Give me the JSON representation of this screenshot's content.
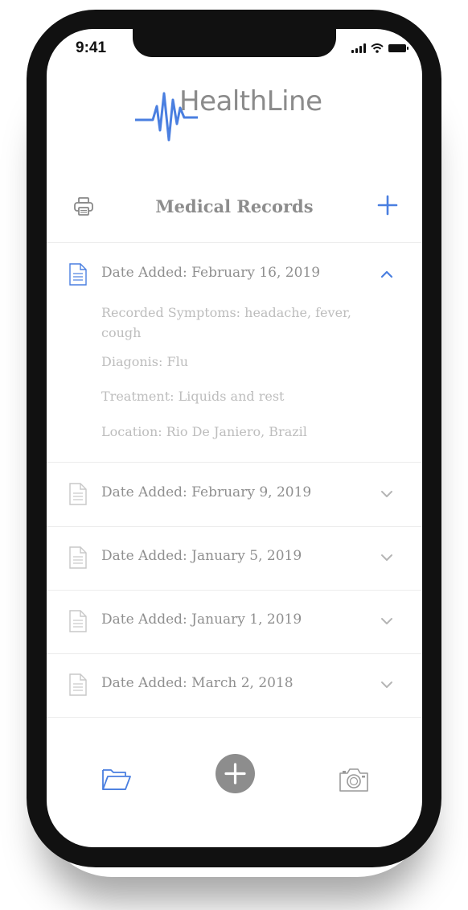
{
  "status_bar": {
    "time": "9:41"
  },
  "app": {
    "name": "HealthLine"
  },
  "header": {
    "title": "Medical Records"
  },
  "records": [
    {
      "date": "Date Added: February 16, 2019",
      "expanded": true,
      "symptoms": "Recorded Symptoms: headache, fever, cough",
      "diagnosis": "Diagonis: Flu",
      "treatment": "Treatment: Liquids and rest",
      "location": "Location: Rio De Janiero, Brazil"
    },
    {
      "date": "Date Added: February 9, 2019",
      "expanded": false
    },
    {
      "date": "Date Added: January 5, 2019",
      "expanded": false
    },
    {
      "date": "Date Added: January 1, 2019",
      "expanded": false
    },
    {
      "date": "Date Added: March 2, 2018",
      "expanded": false
    }
  ],
  "tabbar": {
    "items": [
      "folder-icon",
      "add-icon",
      "camera-icon"
    ],
    "active": "folder-icon"
  },
  "colors": {
    "accent": "#4a7fe0",
    "text": "#8d8d8d",
    "muted": "#bdbdbd",
    "divider": "#ececec"
  }
}
